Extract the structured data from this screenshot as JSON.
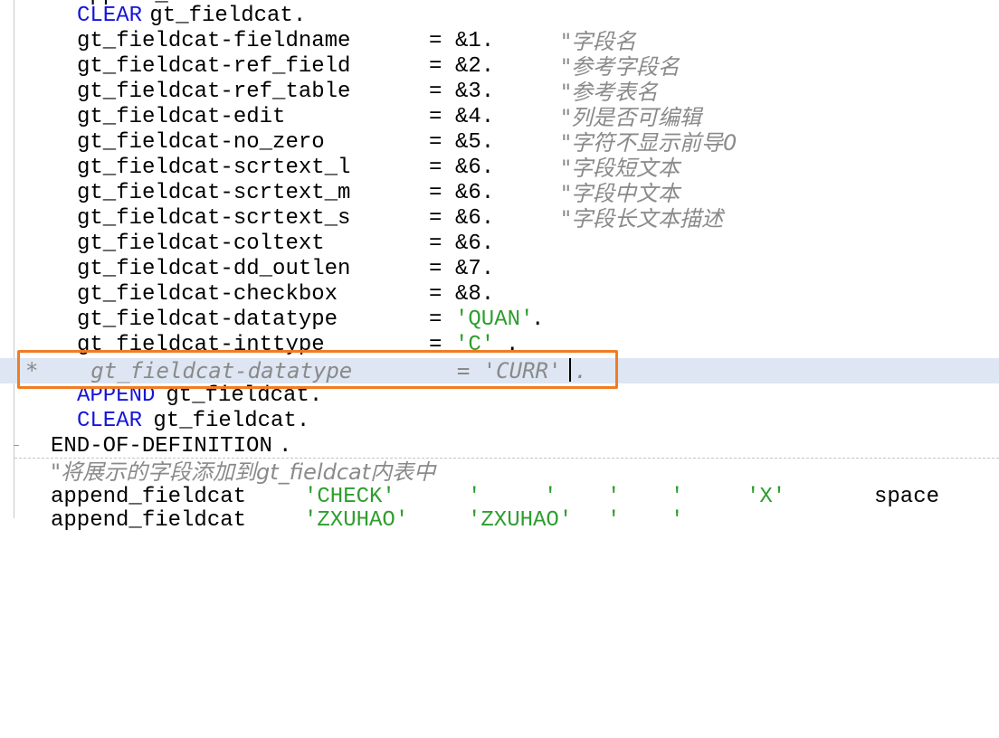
{
  "editor": {
    "top_clipped_text": "append_fi",
    "lines": [
      {
        "indent": "    ",
        "tokens": {
          "kw": "CLEAR",
          "text": " gt_fieldcat."
        }
      },
      {
        "field": "gt_fieldcat-fieldname",
        "eq": "=",
        "value": "&1.",
        "comment": "\"字段名"
      },
      {
        "field": "gt_fieldcat-ref_field",
        "eq": "=",
        "value": "&2.",
        "comment": "\"参考字段名"
      },
      {
        "field": "gt_fieldcat-ref_table",
        "eq": "=",
        "value": "&3.",
        "comment": "\"参考表名"
      },
      {
        "field": "gt_fieldcat-edit",
        "eq": "=",
        "value": "&4.",
        "comment": "\"列是否可编辑"
      },
      {
        "field": "gt_fieldcat-no_zero",
        "eq": "=",
        "value": "&5.",
        "comment": "\"字符不显示前导0"
      },
      {
        "field": "gt_fieldcat-scrtext_l",
        "eq": "=",
        "value": "&6.",
        "comment": "\"字段短文本"
      },
      {
        "field": "gt_fieldcat-scrtext_m",
        "eq": "=",
        "value": "&6.",
        "comment": "\"字段中文本"
      },
      {
        "field": "gt_fieldcat-scrtext_s",
        "eq": "=",
        "value": "&6.",
        "comment": "\"字段长文本描述"
      },
      {
        "field": "gt_fieldcat-coltext",
        "eq": "=",
        "value": "&6."
      },
      {
        "field": "gt_fieldcat-dd_outlen",
        "eq": "=",
        "value": "&7."
      },
      {
        "field": "gt_fieldcat-checkbox",
        "eq": "=",
        "value": "&8."
      },
      {
        "field": "gt_fieldcat-datatype",
        "eq": "=",
        "str": "'QUAN'",
        "tail": "."
      },
      {
        "field": "gt_fieldcat-inttype",
        "eq": "=",
        "str": "'C'",
        "tail": "."
      },
      {
        "commented": "*    gt_fieldcat-datatype        = 'CURR' ."
      },
      {
        "kw": "APPEND",
        "text": " gt_fieldcat."
      },
      {
        "kw": "CLEAR",
        "text": " gt_fieldcat."
      },
      {
        "kw": "END-OF-DEFINITION",
        "text": "."
      },
      {
        "comment": "\"将展示的字段添加到gt_fieldcat内表中"
      },
      {
        "call": "append_fieldcat",
        "args": [
          "'CHECK'",
          "'",
          "'",
          "'",
          "'",
          "'X'",
          "space"
        ]
      }
    ],
    "bottom_clipped": [
      "append_fieldcat",
      "'ZXUHAO'",
      "'ZXUHAO'",
      "'",
      "'"
    ]
  }
}
